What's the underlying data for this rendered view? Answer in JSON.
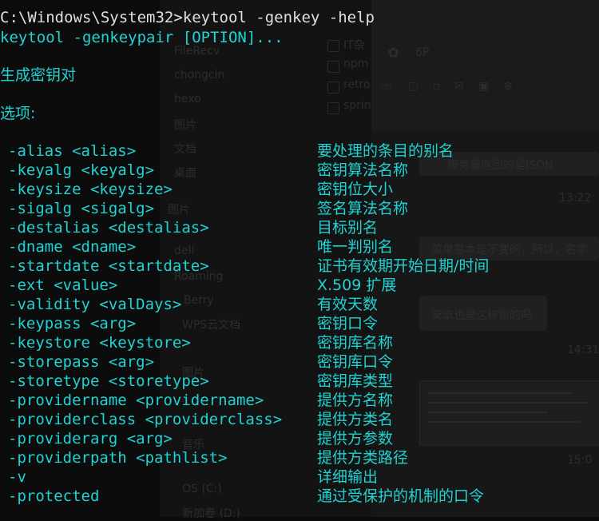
{
  "background_app": {
    "folders": [
      "FileRecv",
      "chongcin",
      "hexo",
      "图片",
      "文档",
      "桌面",
      "图片",
      "dell",
      "Roaming",
      "Berry",
      "WPS云文档",
      "图片",
      "音乐",
      "OS (C:)",
      "新加卷 (D:)"
    ],
    "files": [
      "IT杂",
      "npm",
      "retro",
      "sprin"
    ],
    "chat": {
      "title": "6P",
      "messages": [
        "服务器返回的是JSON",
        "菜单基本是不变的，所以，名字",
        "安卓也是这样做的吗"
      ],
      "timestamps": [
        "13:22",
        "14:31",
        "15:0"
      ]
    }
  },
  "terminal": {
    "prompt_line": "C:\\Windows\\System32>keytool -genkey -help",
    "usage_line": "keytool -genkeypair [OPTION]...",
    "description": "生成密钥对",
    "options_header": "选项:",
    "options": [
      {
        "flag": "-alias <alias>",
        "desc": "要处理的条目的别名"
      },
      {
        "flag": "-keyalg <keyalg>",
        "desc": "密钥算法名称"
      },
      {
        "flag": "-keysize <keysize>",
        "desc": "密钥位大小"
      },
      {
        "flag": "-sigalg <sigalg>",
        "desc": "签名算法名称"
      },
      {
        "flag": "-destalias <destalias>",
        "desc": "目标别名"
      },
      {
        "flag": "-dname <dname>",
        "desc": "唯一判别名"
      },
      {
        "flag": "-startdate <startdate>",
        "desc": "证书有效期开始日期/时间"
      },
      {
        "flag": "-ext <value>",
        "desc": "X.509 扩展"
      },
      {
        "flag": "-validity <valDays>",
        "desc": "有效天数"
      },
      {
        "flag": "-keypass <arg>",
        "desc": "密钥口令"
      },
      {
        "flag": "-keystore <keystore>",
        "desc": "密钥库名称"
      },
      {
        "flag": "-storepass <arg>",
        "desc": "密钥库口令"
      },
      {
        "flag": "-storetype <storetype>",
        "desc": "密钥库类型"
      },
      {
        "flag": "-providername <providername>",
        "desc": "提供方名称"
      },
      {
        "flag": "-providerclass <providerclass>",
        "desc": "提供方类名"
      },
      {
        "flag": "-providerarg <arg>",
        "desc": "提供方参数"
      },
      {
        "flag": "-providerpath <pathlist>",
        "desc": "提供方类路径"
      },
      {
        "flag": "-v",
        "desc": "详细输出"
      },
      {
        "flag": "-protected",
        "desc": "通过受保护的机制的口令"
      }
    ]
  },
  "colors": {
    "text": "#1fd3d3",
    "prompt": "#e0e0e0",
    "background": "#0c0c0c"
  }
}
